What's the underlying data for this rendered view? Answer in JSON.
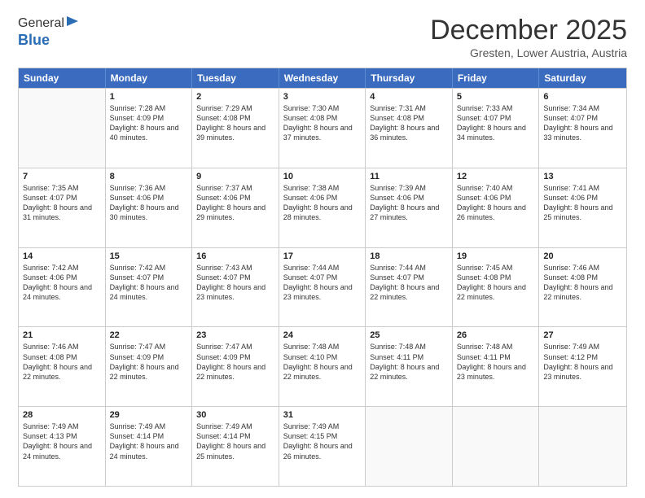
{
  "logo": {
    "general": "General",
    "blue": "Blue"
  },
  "header": {
    "month": "December 2025",
    "location": "Gresten, Lower Austria, Austria"
  },
  "days": [
    "Sunday",
    "Monday",
    "Tuesday",
    "Wednesday",
    "Thursday",
    "Friday",
    "Saturday"
  ],
  "weeks": [
    [
      {
        "day": "",
        "empty": true
      },
      {
        "day": "1",
        "sunrise": "7:28 AM",
        "sunset": "4:09 PM",
        "daylight": "8 hours and 40 minutes."
      },
      {
        "day": "2",
        "sunrise": "7:29 AM",
        "sunset": "4:08 PM",
        "daylight": "8 hours and 39 minutes."
      },
      {
        "day": "3",
        "sunrise": "7:30 AM",
        "sunset": "4:08 PM",
        "daylight": "8 hours and 37 minutes."
      },
      {
        "day": "4",
        "sunrise": "7:31 AM",
        "sunset": "4:08 PM",
        "daylight": "8 hours and 36 minutes."
      },
      {
        "day": "5",
        "sunrise": "7:33 AM",
        "sunset": "4:07 PM",
        "daylight": "8 hours and 34 minutes."
      },
      {
        "day": "6",
        "sunrise": "7:34 AM",
        "sunset": "4:07 PM",
        "daylight": "8 hours and 33 minutes."
      }
    ],
    [
      {
        "day": "7",
        "sunrise": "7:35 AM",
        "sunset": "4:07 PM",
        "daylight": "8 hours and 31 minutes."
      },
      {
        "day": "8",
        "sunrise": "7:36 AM",
        "sunset": "4:06 PM",
        "daylight": "8 hours and 30 minutes."
      },
      {
        "day": "9",
        "sunrise": "7:37 AM",
        "sunset": "4:06 PM",
        "daylight": "8 hours and 29 minutes."
      },
      {
        "day": "10",
        "sunrise": "7:38 AM",
        "sunset": "4:06 PM",
        "daylight": "8 hours and 28 minutes."
      },
      {
        "day": "11",
        "sunrise": "7:39 AM",
        "sunset": "4:06 PM",
        "daylight": "8 hours and 27 minutes."
      },
      {
        "day": "12",
        "sunrise": "7:40 AM",
        "sunset": "4:06 PM",
        "daylight": "8 hours and 26 minutes."
      },
      {
        "day": "13",
        "sunrise": "7:41 AM",
        "sunset": "4:06 PM",
        "daylight": "8 hours and 25 minutes."
      }
    ],
    [
      {
        "day": "14",
        "sunrise": "7:42 AM",
        "sunset": "4:06 PM",
        "daylight": "8 hours and 24 minutes."
      },
      {
        "day": "15",
        "sunrise": "7:42 AM",
        "sunset": "4:07 PM",
        "daylight": "8 hours and 24 minutes."
      },
      {
        "day": "16",
        "sunrise": "7:43 AM",
        "sunset": "4:07 PM",
        "daylight": "8 hours and 23 minutes."
      },
      {
        "day": "17",
        "sunrise": "7:44 AM",
        "sunset": "4:07 PM",
        "daylight": "8 hours and 23 minutes."
      },
      {
        "day": "18",
        "sunrise": "7:44 AM",
        "sunset": "4:07 PM",
        "daylight": "8 hours and 22 minutes."
      },
      {
        "day": "19",
        "sunrise": "7:45 AM",
        "sunset": "4:08 PM",
        "daylight": "8 hours and 22 minutes."
      },
      {
        "day": "20",
        "sunrise": "7:46 AM",
        "sunset": "4:08 PM",
        "daylight": "8 hours and 22 minutes."
      }
    ],
    [
      {
        "day": "21",
        "sunrise": "7:46 AM",
        "sunset": "4:08 PM",
        "daylight": "8 hours and 22 minutes."
      },
      {
        "day": "22",
        "sunrise": "7:47 AM",
        "sunset": "4:09 PM",
        "daylight": "8 hours and 22 minutes."
      },
      {
        "day": "23",
        "sunrise": "7:47 AM",
        "sunset": "4:09 PM",
        "daylight": "8 hours and 22 minutes."
      },
      {
        "day": "24",
        "sunrise": "7:48 AM",
        "sunset": "4:10 PM",
        "daylight": "8 hours and 22 minutes."
      },
      {
        "day": "25",
        "sunrise": "7:48 AM",
        "sunset": "4:11 PM",
        "daylight": "8 hours and 22 minutes."
      },
      {
        "day": "26",
        "sunrise": "7:48 AM",
        "sunset": "4:11 PM",
        "daylight": "8 hours and 23 minutes."
      },
      {
        "day": "27",
        "sunrise": "7:49 AM",
        "sunset": "4:12 PM",
        "daylight": "8 hours and 23 minutes."
      }
    ],
    [
      {
        "day": "28",
        "sunrise": "7:49 AM",
        "sunset": "4:13 PM",
        "daylight": "8 hours and 24 minutes."
      },
      {
        "day": "29",
        "sunrise": "7:49 AM",
        "sunset": "4:14 PM",
        "daylight": "8 hours and 24 minutes."
      },
      {
        "day": "30",
        "sunrise": "7:49 AM",
        "sunset": "4:14 PM",
        "daylight": "8 hours and 25 minutes."
      },
      {
        "day": "31",
        "sunrise": "7:49 AM",
        "sunset": "4:15 PM",
        "daylight": "8 hours and 26 minutes."
      },
      {
        "day": "",
        "empty": true
      },
      {
        "day": "",
        "empty": true
      },
      {
        "day": "",
        "empty": true
      }
    ]
  ]
}
